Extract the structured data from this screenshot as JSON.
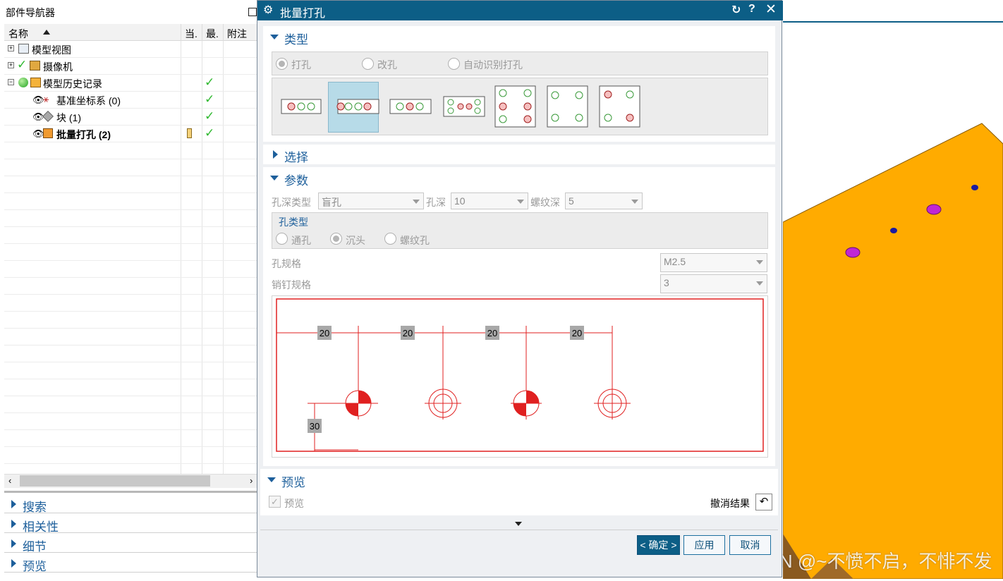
{
  "navigator": {
    "title": "部件导航器",
    "columns": [
      "名称",
      "当.",
      "最.",
      "附注"
    ],
    "tree": [
      {
        "label": "模型视图",
        "status": ""
      },
      {
        "label": "摄像机",
        "status": ""
      },
      {
        "label": "模型历史记录",
        "status": "ok"
      },
      {
        "label": "基准坐标系 (0)",
        "status": "ok"
      },
      {
        "label": "块 (1)",
        "status": "ok"
      },
      {
        "label": "批量打孔 (2)",
        "status": "ok"
      }
    ],
    "sections": [
      "搜索",
      "相关性",
      "细节",
      "预览"
    ]
  },
  "dialog": {
    "title": "批量打孔",
    "type_section": {
      "header": "类型",
      "options": [
        "打孔",
        "改孔",
        "自动识别打孔"
      ],
      "selected": "打孔",
      "selected_layout_index": 1
    },
    "select_section": {
      "header": "选择"
    },
    "params_section": {
      "header": "参数",
      "depth_type_label": "孔深类型",
      "depth_type_value": "盲孔",
      "depth_label": "孔深",
      "depth_value": "10",
      "thread_depth_label": "螺纹深",
      "thread_depth_value": "5",
      "hole_type_group": "孔类型",
      "hole_types": [
        "通孔",
        "沉头",
        "螺纹孔"
      ],
      "hole_type_selected": "沉头",
      "spec_label": "孔规格",
      "spec_value": "M2.5",
      "pin_label": "销钉规格",
      "pin_value": "3",
      "diagram_spacing_labels": [
        "20",
        "20",
        "20",
        "20"
      ],
      "diagram_offset_label": "30"
    },
    "preview_section": {
      "header": "预览",
      "checkbox_label": "预览",
      "checked": true,
      "undo_label": "撤消结果"
    },
    "buttons": {
      "ok": "< 确定 >",
      "apply": "应用",
      "cancel": "取消"
    }
  },
  "watermark": "CSDN @~不愤不启，不悱不发",
  "colors": {
    "titlebar": "#0c5e86",
    "accent": "#1d5f9b",
    "part": "#ffab00",
    "hole": "#c026d3"
  }
}
